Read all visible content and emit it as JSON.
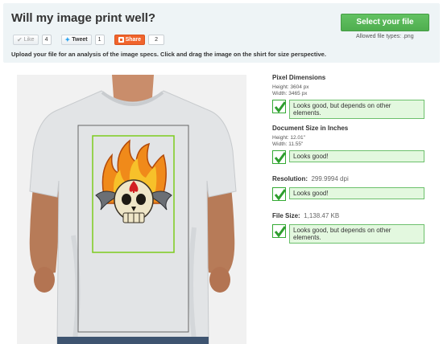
{
  "header": {
    "title": "Will my image print well?",
    "instructions": "Upload your file for an analysis of the image specs. Click and drag the image on the shirt for size perspective."
  },
  "social": {
    "like_label": "Like",
    "like_count": "4",
    "tweet_label": "Tweet",
    "tweet_count": "1",
    "share_label": "Share",
    "share_count": "2"
  },
  "upload": {
    "button_label": "Select your file",
    "allowed_types": "Allowed file types: .png"
  },
  "analysis": {
    "pixel_dimensions": {
      "title": "Pixel Dimensions",
      "height": "Height: 3604 px",
      "width": "Width: 3465 px",
      "status": "Looks good, but depends on other elements."
    },
    "document_size": {
      "title": "Document Size in Inches",
      "height": "Height: 12.01\"",
      "width": "Width: 11.55\"",
      "status": "Looks good!"
    },
    "resolution": {
      "label": "Resolution:",
      "value": "299.9994 dpi",
      "status": "Looks good!"
    },
    "file_size": {
      "label": "File Size:",
      "value": "1,138.47 KB",
      "status": "Looks good, but depends on other elements."
    }
  },
  "colors": {
    "accent_green": "#5cb85c",
    "status_bg": "#e3f8df",
    "status_border": "#6cc06c",
    "share_orange": "#f0642c",
    "print_area_outline": "#666666",
    "image_outline": "#7ccc1e"
  }
}
